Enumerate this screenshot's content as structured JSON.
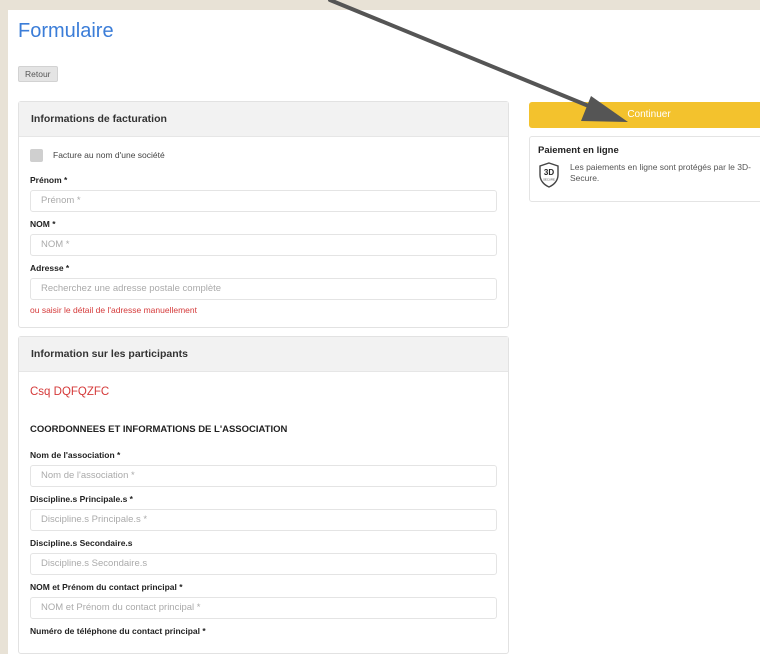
{
  "header": {
    "title": "Formulaire",
    "back_label": "Retour"
  },
  "billing": {
    "heading": "Informations de facturation",
    "company_checkbox_label": "Facture au nom d'une société",
    "first_name": {
      "label": "Prénom *",
      "placeholder": "Prénom *"
    },
    "last_name": {
      "label": "NOM *",
      "placeholder": "NOM *"
    },
    "address": {
      "label": "Adresse *",
      "placeholder": "Recherchez une adresse postale complète"
    },
    "manual_address_link": "ou saisir le détail de l'adresse manuellement"
  },
  "participants": {
    "heading": "Information sur les participants",
    "participant_name": "Csq DQFQZFC",
    "section_title": "COORDONNEES ET INFORMATIONS DE L'ASSOCIATION",
    "fields": [
      {
        "label": "Nom de l'association *",
        "placeholder": "Nom de l'association *"
      },
      {
        "label": "Discipline.s Principale.s *",
        "placeholder": "Discipline.s Principale.s *"
      },
      {
        "label": "Discipline.s Secondaire.s",
        "placeholder": "Discipline.s Secondaire.s"
      },
      {
        "label": "NOM et Prénom du contact principal *",
        "placeholder": "NOM et Prénom du contact principal *"
      },
      {
        "label": "Numéro de téléphone du contact principal *"
      }
    ]
  },
  "sidebar": {
    "continue_label": "Continuer",
    "payment_title": "Paiement en ligne",
    "secure_text": "Les paiements en ligne sont protégés par le 3D-Secure.",
    "secure_badge_main": "3D",
    "secure_badge_sub": "SECURE"
  },
  "colors": {
    "accent": "#3b7dd8",
    "button": "#f3c22d",
    "link": "#d53a3a",
    "annotation_arrow": "#555555"
  },
  "icons": {
    "secure_badge": "3d-secure-shield-icon",
    "annotation": "arrow-annotation-icon"
  }
}
